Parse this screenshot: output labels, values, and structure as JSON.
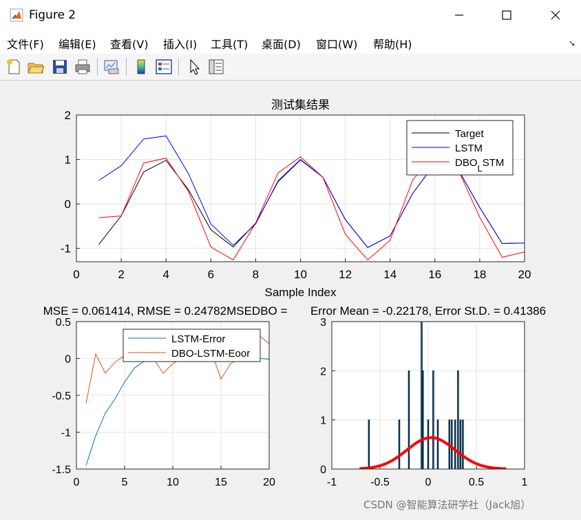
{
  "window": {
    "title": "Figure 2"
  },
  "menu": [
    "文件(F)",
    "编辑(E)",
    "查看(V)",
    "插入(I)",
    "工具(T)",
    "桌面(D)",
    "窗口(W)",
    "帮助(H)"
  ],
  "toolbar": {
    "buttons": [
      "new-figure-icon",
      "open-folder-icon",
      "save-icon",
      "print-icon",
      "link-plot-icon",
      "colorbar-icon",
      "legend-icon",
      "pointer-icon",
      "property-inspector-icon"
    ]
  },
  "watermark": "CSDN @智能算法研学社（Jack旭）",
  "colors": {
    "target": "#000000",
    "lstm": "#0000ff",
    "dbo": "#ff0000",
    "err1": "#0072bd",
    "err2": "#d95319",
    "hist_bar": "#0072bd",
    "fit": "#ff0000"
  },
  "chart_data": [
    {
      "type": "line",
      "title": "测试集结果",
      "xlabel": "Sample Index",
      "ylabel": "",
      "xlim": [
        0,
        20
      ],
      "ylim": [
        -1.3,
        2
      ],
      "xticks": [
        0,
        2,
        4,
        6,
        8,
        10,
        12,
        14,
        16,
        18,
        20
      ],
      "yticks": [
        -1,
        0,
        1,
        2
      ],
      "grid": true,
      "legend_position": "top-right",
      "x": [
        1,
        2,
        3,
        4,
        5,
        6,
        7,
        8,
        9,
        10,
        11,
        12,
        13,
        14,
        15,
        16,
        17,
        18,
        19,
        20
      ],
      "series": [
        {
          "name": "Target",
          "color": "#000000",
          "values": [
            -0.91,
            -0.27,
            0.72,
            0.98,
            0.32,
            -0.58,
            -0.97,
            -0.43,
            0.5,
            0.99,
            0.6,
            -0.35,
            -0.98,
            -0.72,
            0.23,
            0.91,
            0.81,
            -0.08,
            -0.89,
            -0.88
          ]
        },
        {
          "name": "LSTM",
          "color": "#0000ff",
          "values": [
            0.53,
            0.86,
            1.46,
            1.53,
            0.68,
            -0.45,
            -0.93,
            -0.45,
            0.52,
            1.0,
            0.6,
            -0.35,
            -0.98,
            -0.72,
            0.23,
            0.91,
            0.81,
            -0.08,
            -0.89,
            -0.88
          ]
        },
        {
          "name": "DBO_LSTM",
          "color": "#ff0000",
          "values": [
            -0.31,
            -0.27,
            0.92,
            1.03,
            0.28,
            -0.97,
            -1.26,
            -0.43,
            0.7,
            1.06,
            0.6,
            -0.68,
            -1.26,
            -0.82,
            0.53,
            1.16,
            0.81,
            -0.3,
            -1.2,
            -1.08
          ]
        }
      ]
    },
    {
      "type": "line",
      "title": "MSE = 0.061414, RMSE = 0.24782MSEDBO = ",
      "xlabel": "",
      "ylabel": "",
      "xlim": [
        0,
        20
      ],
      "ylim": [
        -1.5,
        0.5
      ],
      "xticks": [
        0,
        5,
        10,
        15,
        20
      ],
      "yticks": [
        -1.5,
        -1,
        -0.5,
        0,
        0.5
      ],
      "yticklabels": [
        "-1.5",
        "-1",
        "-0.5",
        "0",
        "0.5"
      ],
      "grid": true,
      "legend_position": "top-right",
      "x": [
        1,
        2,
        3,
        4,
        5,
        6,
        7,
        8,
        9,
        10,
        11,
        12,
        13,
        14,
        15,
        16,
        17,
        18,
        19,
        20
      ],
      "series": [
        {
          "name": "LSTM-Error",
          "color": "#0072bd",
          "values": [
            -1.45,
            -1.05,
            -0.74,
            -0.55,
            -0.32,
            -0.13,
            -0.04,
            0.0,
            0.0,
            0.0,
            0.0,
            0.0,
            0.0,
            0.0,
            0.0,
            0.0,
            0.0,
            0.0,
            0.0,
            -0.01
          ]
        },
        {
          "name": "DBO-LSTM-Eoor",
          "color": "#d95319",
          "values": [
            -0.61,
            0.06,
            -0.2,
            -0.05,
            0.04,
            0.38,
            0.29,
            0.0,
            -0.2,
            -0.07,
            0.0,
            0.33,
            0.28,
            0.1,
            -0.28,
            -0.07,
            0.0,
            0.22,
            0.31,
            0.2
          ]
        }
      ]
    },
    {
      "type": "bar",
      "title": "Error Mean = -0.22178, Error St.D. = 0.41386",
      "xlabel": "",
      "ylabel": "",
      "xlim": [
        -1,
        1
      ],
      "ylim": [
        0,
        3
      ],
      "xticks": [
        -1,
        -0.5,
        0,
        0.5,
        1
      ],
      "xticklabels": [
        "-1",
        "-0.5",
        "0",
        "0.5",
        "1"
      ],
      "yticks": [
        0,
        1,
        2,
        3
      ],
      "grid": true,
      "bin_width": 0.012,
      "bins": [
        {
          "x": -0.615,
          "count": 1
        },
        {
          "x": -0.3,
          "count": 1
        },
        {
          "x": -0.2,
          "count": 2
        },
        {
          "x": -0.068,
          "count": 3
        },
        {
          "x": -0.055,
          "count": 2
        },
        {
          "x": 0.0,
          "count": 1
        },
        {
          "x": 0.053,
          "count": 2
        },
        {
          "x": 0.1,
          "count": 1
        },
        {
          "x": 0.22,
          "count": 1
        },
        {
          "x": 0.245,
          "count": 1
        },
        {
          "x": 0.28,
          "count": 1
        },
        {
          "x": 0.31,
          "count": 2
        },
        {
          "x": 0.335,
          "count": 1
        },
        {
          "x": 0.36,
          "count": 1
        }
      ],
      "fit_curve": {
        "color": "#ff0000",
        "mean": 0.03,
        "std": 0.25,
        "peak": 0.64,
        "xrange": [
          -0.7,
          0.8
        ]
      }
    }
  ]
}
